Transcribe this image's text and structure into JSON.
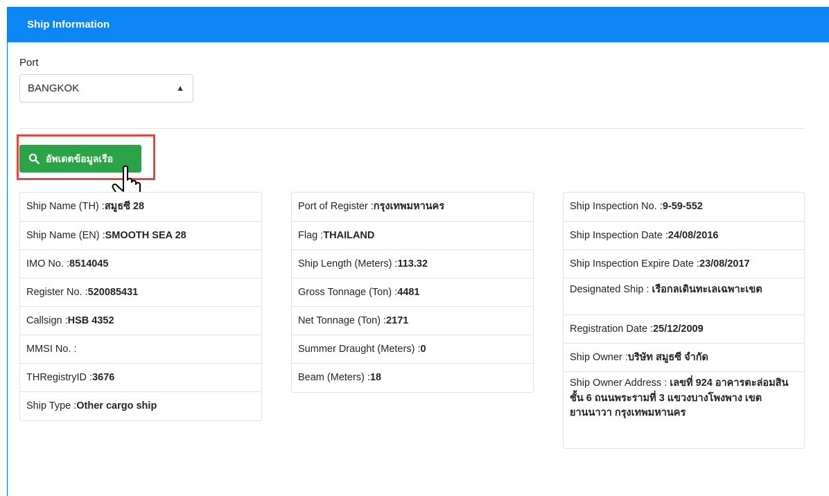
{
  "card": {
    "title": "Ship Information"
  },
  "port": {
    "label": "Port",
    "value": "BANGKOK"
  },
  "update_button": {
    "label": "อัพเดตข้อมูลเรือ"
  },
  "col1": [
    {
      "label": "Ship Name (TH) : ",
      "value": "สมูธซี 28"
    },
    {
      "label": "Ship Name (EN) : ",
      "value": "SMOOTH SEA 28"
    },
    {
      "label": "IMO No. : ",
      "value": "8514045"
    },
    {
      "label": "Register No. : ",
      "value": "520085431"
    },
    {
      "label": "Callsign : ",
      "value": "HSB 4352"
    },
    {
      "label": "MMSI No. : ",
      "value": ""
    },
    {
      "label": "THRegistryID : ",
      "value": "3676"
    },
    {
      "label": "Ship Type : ",
      "value": "Other cargo ship"
    }
  ],
  "col2": [
    {
      "label": "Port of Register : ",
      "value": "กรุงเทพมหานคร"
    },
    {
      "label": "Flag : ",
      "value": "THAILAND"
    },
    {
      "label": "Ship Length (Meters) : ",
      "value": "113.32"
    },
    {
      "label": "Gross Tonnage (Ton) : ",
      "value": "4481"
    },
    {
      "label": "Net Tonnage (Ton) : ",
      "value": "2171"
    },
    {
      "label": "Summer Draught (Meters) : ",
      "value": "0"
    },
    {
      "label": "Beam (Meters) : ",
      "value": "18"
    }
  ],
  "col3": [
    {
      "label": "Ship Inspection No. : ",
      "value": "9-59-552"
    },
    {
      "label": "Ship Inspection Date : ",
      "value": "24/08/2016"
    },
    {
      "label": "Ship Inspection Expire Date : ",
      "value": "23/08/2017"
    },
    {
      "label": "Designated Ship : ",
      "value": "เรือกลเดินทะเลเฉพาะเขต"
    },
    {
      "label": "Registration Date : ",
      "value": "25/12/2009"
    },
    {
      "label": "Ship Owner : ",
      "value": "บริษัท สมูธซี จำกัด"
    },
    {
      "label": "Ship Owner Address : ",
      "value": "เลขที่ 924 อาคารตะล่อมสิน ชั้น 6 ถนนพระรามที่ 3 แขวงบางโพงพาง เขตยานนาวา กรุงเทพมหานคร"
    }
  ]
}
